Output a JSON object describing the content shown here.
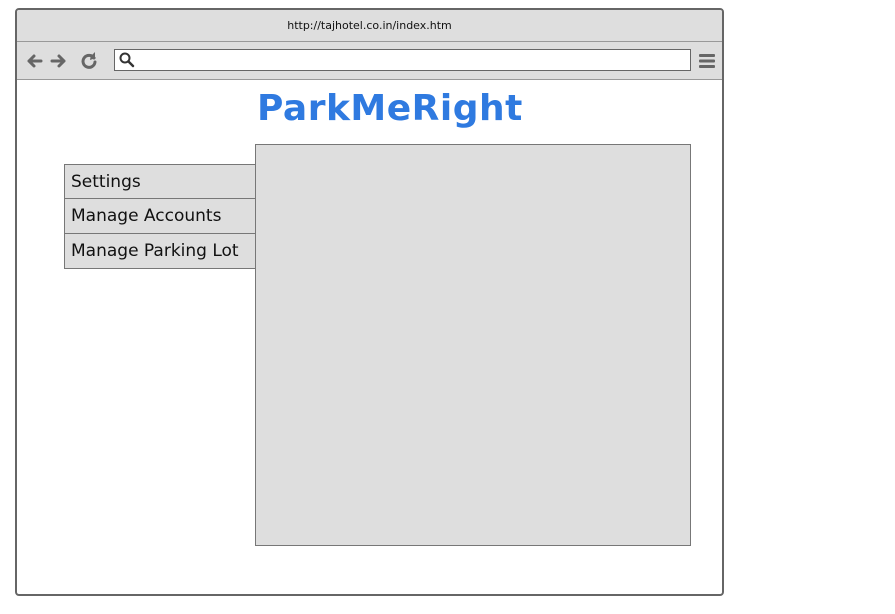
{
  "browser": {
    "url": "http://tajhotel.co.in/index.htm",
    "search_value": "",
    "icons": [
      "back-arrow-icon",
      "forward-arrow-icon",
      "reload-icon",
      "search-icon",
      "hamburger-menu-icon"
    ]
  },
  "app": {
    "title": "ParkMeRight",
    "title_color": "#2f7ae0"
  },
  "sidebar": {
    "items": [
      {
        "label": "Settings"
      },
      {
        "label": "Manage Accounts"
      },
      {
        "label": "Manage Parking Lot"
      }
    ]
  },
  "colors": {
    "panel_bg": "#dedede",
    "chrome_bg": "#dedede",
    "border": "#666666"
  }
}
